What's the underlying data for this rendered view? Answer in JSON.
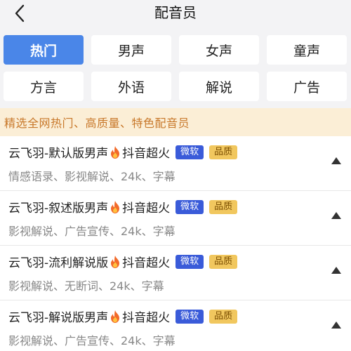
{
  "header": {
    "title": "配音员",
    "back_icon": "chevron-left-icon"
  },
  "categories": [
    {
      "label": "热门",
      "active": true
    },
    {
      "label": "男声",
      "active": false
    },
    {
      "label": "女声",
      "active": false
    },
    {
      "label": "童声",
      "active": false
    },
    {
      "label": "方言",
      "active": false
    },
    {
      "label": "外语",
      "active": false
    },
    {
      "label": "解说",
      "active": false
    },
    {
      "label": "广告",
      "active": false
    }
  ],
  "banner": {
    "text": "精选全网热门、高质量、特色配音员"
  },
  "voices": [
    {
      "name": "云飞羽-默认版男声",
      "tag": "抖音超火",
      "badge1": "微软",
      "badge2": "品质",
      "desc": "情感语录、影视解说、24k、字幕"
    },
    {
      "name": "云飞羽-叙述版男声",
      "tag": "抖音超火",
      "badge1": "微软",
      "badge2": "品质",
      "desc": "影视解说、广告宣传、24k、字幕"
    },
    {
      "name": "云飞羽-流利解说版",
      "tag": "抖音超火",
      "badge1": "微软",
      "badge2": "品质",
      "desc": "影视解说、无断词、24k、字幕"
    },
    {
      "name": "云飞羽-解说版男声",
      "tag": "抖音超火",
      "badge1": "微软",
      "badge2": "品质",
      "desc": "影视解说、广告宣传、24k、字幕"
    }
  ],
  "colors": {
    "accent": "#4a86e8",
    "banner_bg": "#fbeed6",
    "banner_text": "#c8782a",
    "badge_blue": "#3a5bd9",
    "badge_gold": "#f1c75e"
  },
  "icons": {
    "flame": "flame-icon",
    "expand": "triangle-up-icon"
  }
}
